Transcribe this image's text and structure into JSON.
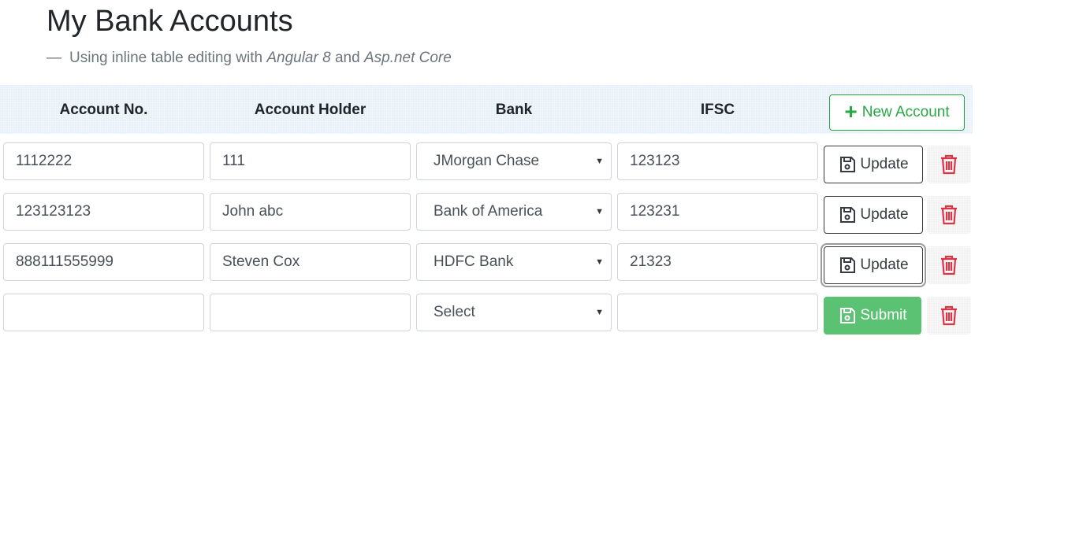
{
  "header": {
    "title": "My Bank Accounts",
    "subtitle_dash": "—",
    "subtitle_prefix": "Using inline table editing with",
    "subtitle_tech1": "Angular 8",
    "subtitle_and": "and",
    "subtitle_tech2": "Asp.net Core"
  },
  "table": {
    "columns": [
      "Account No.",
      "Account Holder",
      "Bank",
      "IFSC"
    ],
    "new_button_label": "New Account",
    "rows": [
      {
        "account_no": "1112222",
        "holder": "111",
        "bank": "JMorgan Chase",
        "ifsc": "123123",
        "action": "Update"
      },
      {
        "account_no": "123123123",
        "holder": "John abc",
        "bank": "Bank of America",
        "ifsc": "123231",
        "action": "Update"
      },
      {
        "account_no": "888111555999",
        "holder": "Steven Cox",
        "bank": "HDFC Bank",
        "ifsc": "21323",
        "action": "Update"
      },
      {
        "account_no": "",
        "holder": "",
        "bank": "Select",
        "ifsc": "",
        "action": "Submit"
      }
    ]
  },
  "colors": {
    "success": "#28a745",
    "danger": "#dc3545",
    "dark": "#343a40",
    "header_bg": "#e8f1f9"
  },
  "icons": {
    "new": "plus-icon",
    "save": "floppy-disk-icon",
    "delete": "trash-icon"
  }
}
